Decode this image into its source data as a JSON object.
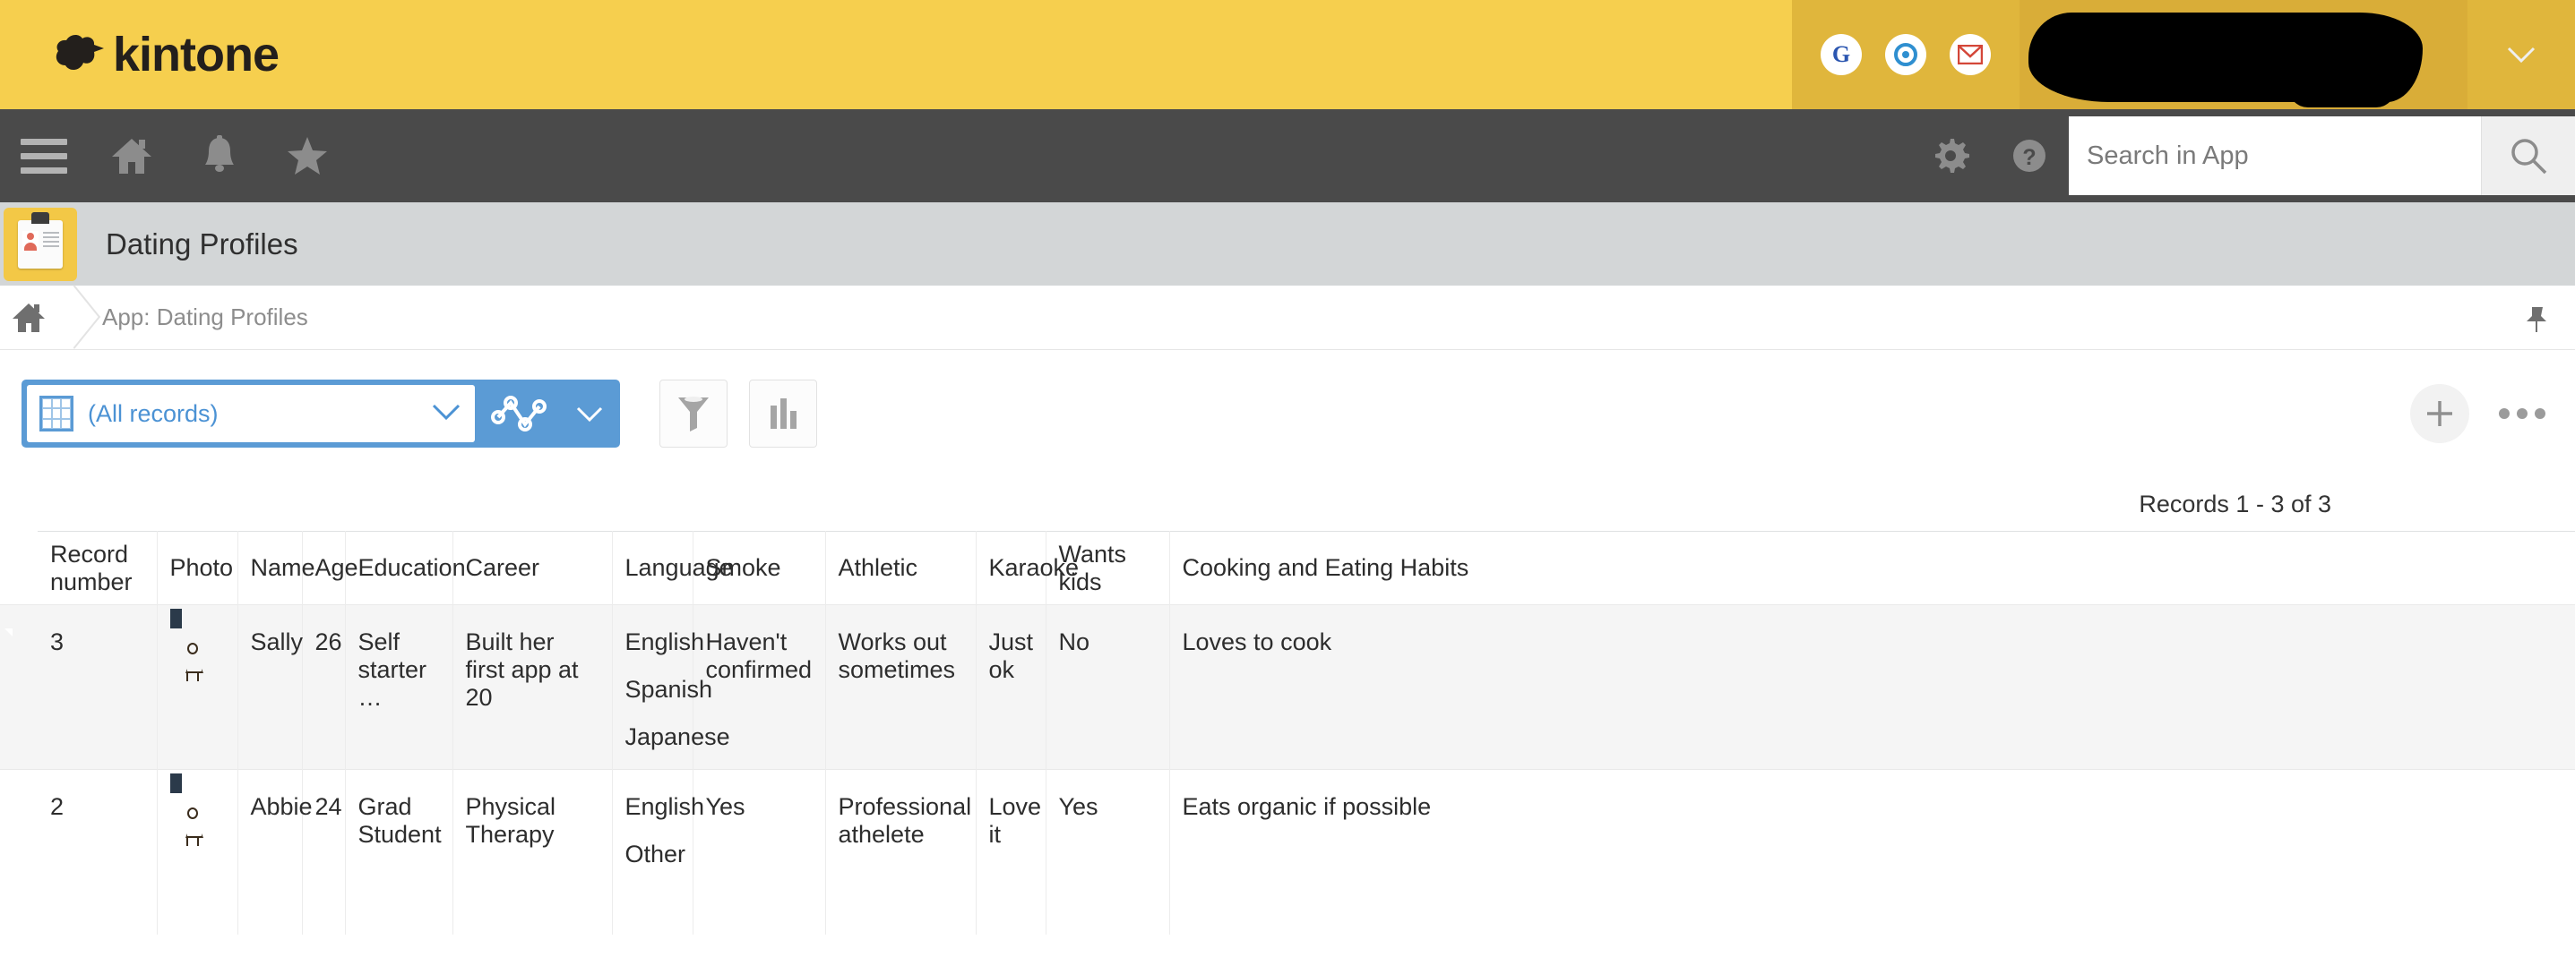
{
  "header": {
    "brand": "kintone",
    "service_icons": [
      {
        "name": "google-icon",
        "glyph": "G"
      },
      {
        "name": "office-circle-icon",
        "glyph": "O"
      },
      {
        "name": "gmail-icon",
        "glyph": "M"
      }
    ],
    "user_name": "",
    "user_chevron": "∨"
  },
  "navbar": {
    "menu_label": "menu",
    "home_label": "home",
    "notifications_label": "notifications",
    "favorites_label": "favorites",
    "settings_label": "settings",
    "help_label": "help",
    "search": {
      "placeholder": "Search in App",
      "value": ""
    }
  },
  "app": {
    "title": "Dating Profiles"
  },
  "breadcrumb": {
    "home": "Home",
    "current": "App: Dating Profiles"
  },
  "toolbar": {
    "view_label": "(All records)",
    "view_chevron": "∨",
    "chart_chevron": "∨",
    "filter_label": "Filter",
    "graph_label": "Graph",
    "add_label": "+",
    "more_label": "More"
  },
  "records_summary": "Records 1 - 3 of 3",
  "table": {
    "columns": [
      "Record number",
      "Photo",
      "Name",
      "Age",
      "Education",
      "Career",
      "Language",
      "Smoke",
      "Athletic",
      "Karaoke",
      "Wants kids",
      "Cooking and Eating Habits"
    ],
    "rows": [
      {
        "record_number": "3",
        "photo": "profile-photo",
        "name": "Sally",
        "age": "26",
        "education": "Self starter …",
        "career": "Built her first app at 20",
        "language": [
          "English",
          "Spanish",
          "Japanese"
        ],
        "smoke": "Haven't confirmed",
        "athletic": "Works out sometimes",
        "karaoke": "Just ok",
        "wants_kids": "No",
        "cooking": "Loves to cook"
      },
      {
        "record_number": "2",
        "photo": "profile-photo",
        "name": "Abbie",
        "age": "24",
        "education": "Grad Student",
        "career": "Physical Therapy",
        "language": [
          "English",
          "Other"
        ],
        "smoke": "Yes",
        "athletic": "Professional athelete",
        "karaoke": "Love it",
        "wants_kids": "Yes",
        "cooking": "Eats organic if possible"
      }
    ]
  },
  "colors": {
    "brand_yellow": "#f6cf4e",
    "nav_dark": "#4a4a4a",
    "accent_blue": "#5b9bd5",
    "app_bar_gray": "#d3d6d7"
  }
}
